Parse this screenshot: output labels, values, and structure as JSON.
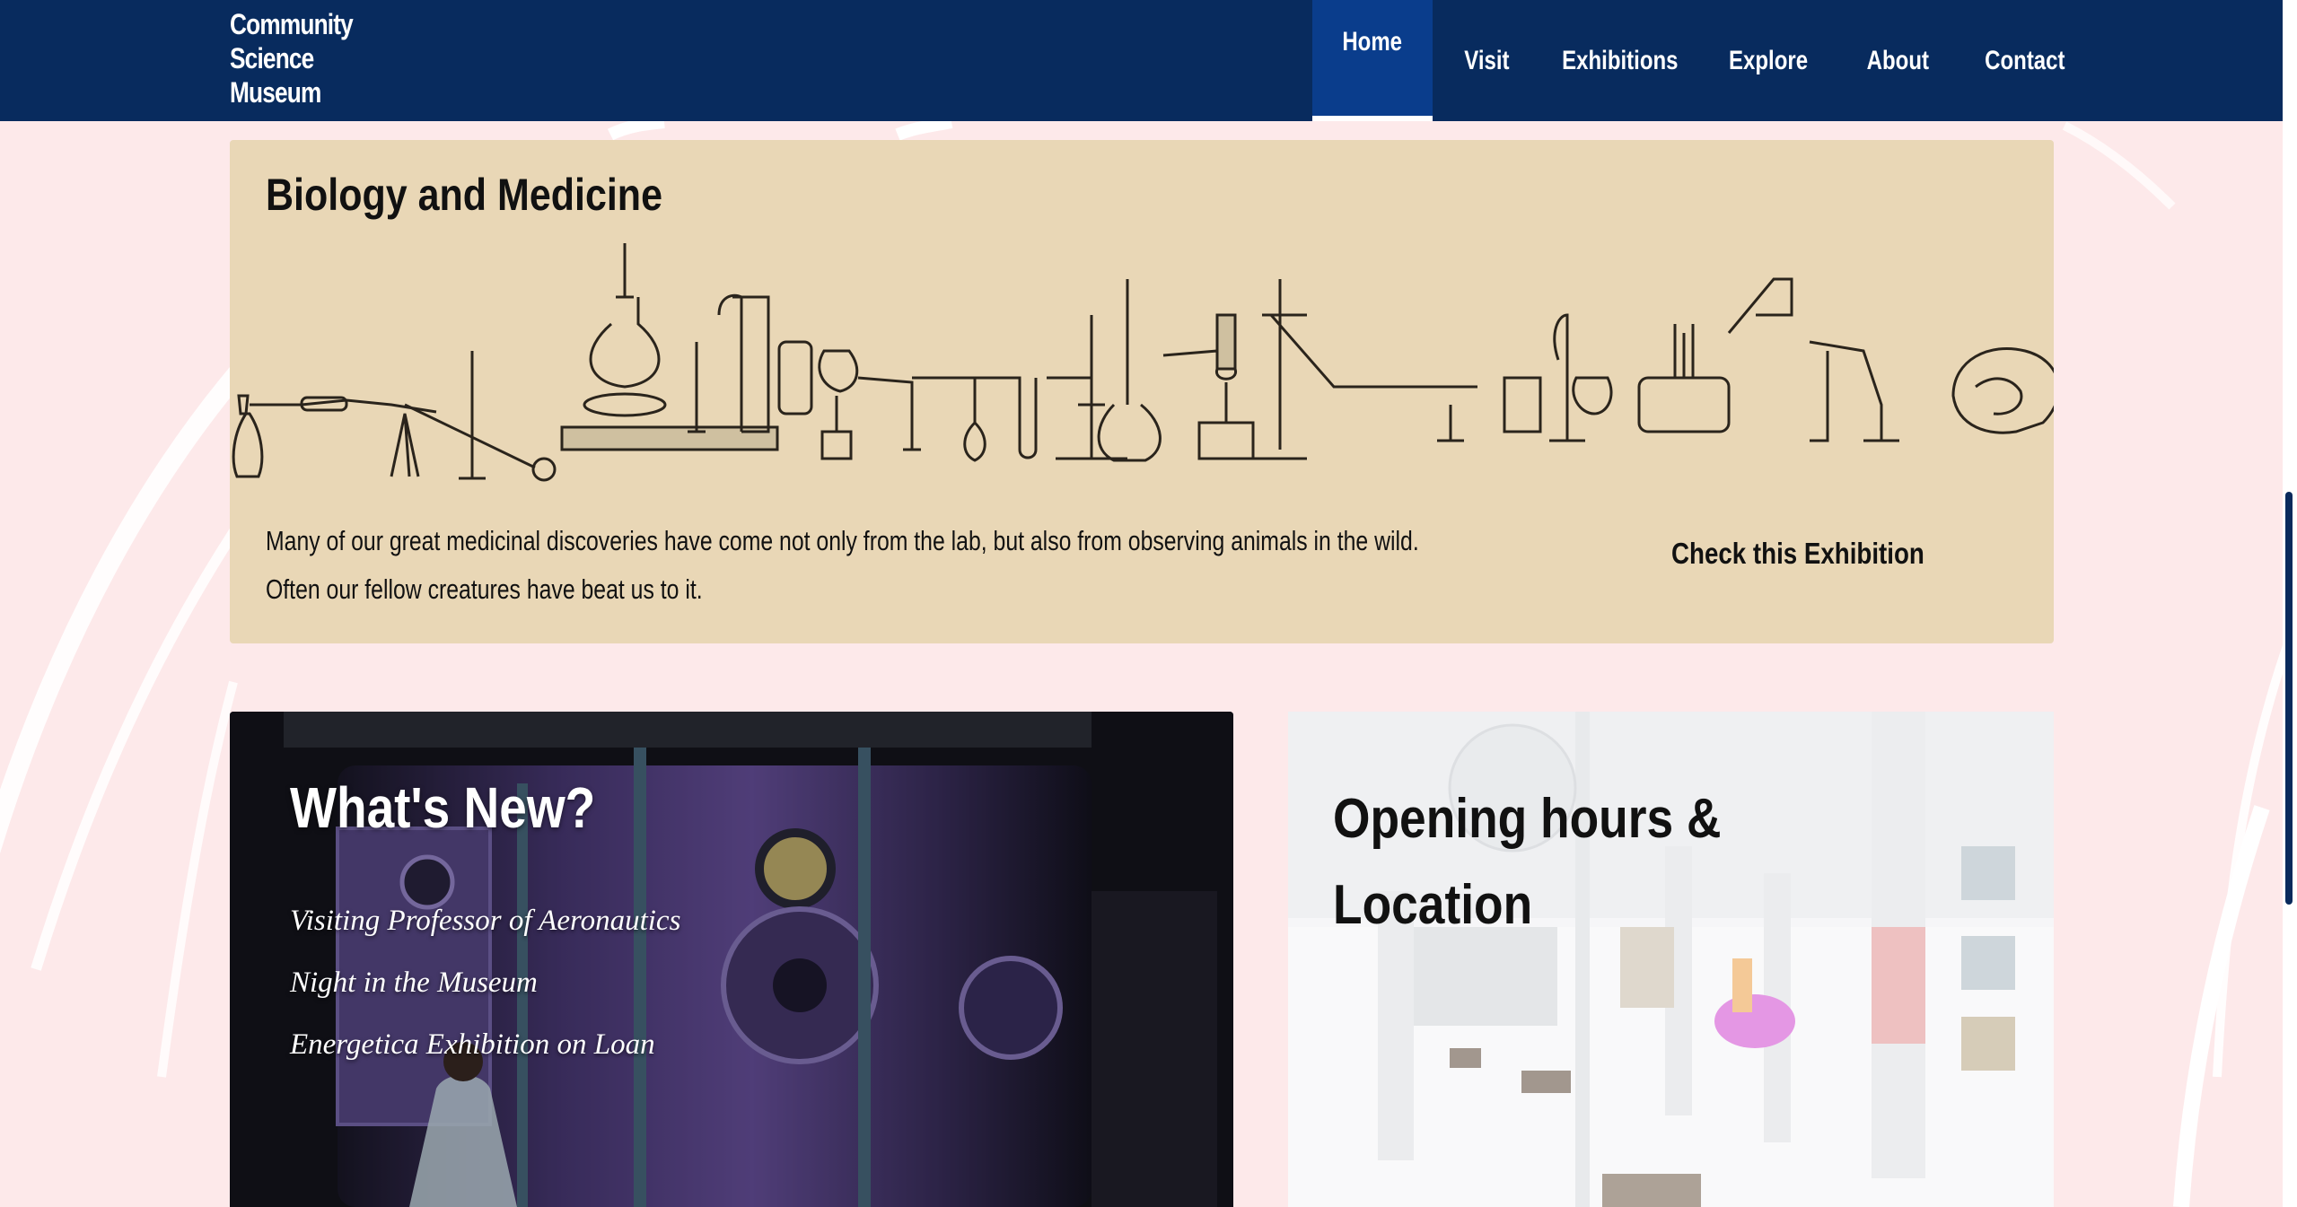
{
  "site": {
    "logo_lines": [
      "Community",
      "Science",
      "Museum"
    ]
  },
  "nav": {
    "items": [
      "Home",
      "Visit",
      "Exhibitions",
      "Explore",
      "About",
      "Contact"
    ],
    "active": "Home"
  },
  "biology": {
    "title": "Biology and Medicine",
    "text_line1": "Many of our great medicinal discoveries have come not only from the lab, but also from observing animals in the wild.",
    "text_line2": "Often our fellow creatures have beat us to it.",
    "link_label": "Check this Exhibition"
  },
  "whats_new": {
    "title": "What's New?",
    "items": [
      "Visiting Professor of Aeronautics",
      "Night in the Museum",
      "Energetica Exhibition on Loan"
    ]
  },
  "hours": {
    "title": "Opening hours & Location"
  },
  "colors": {
    "header_bg": "#082b5e",
    "active_nav_bg": "#0a3d8c",
    "page_bg": "#fde9ea",
    "bio_card_bg": "#e9d7b6"
  }
}
